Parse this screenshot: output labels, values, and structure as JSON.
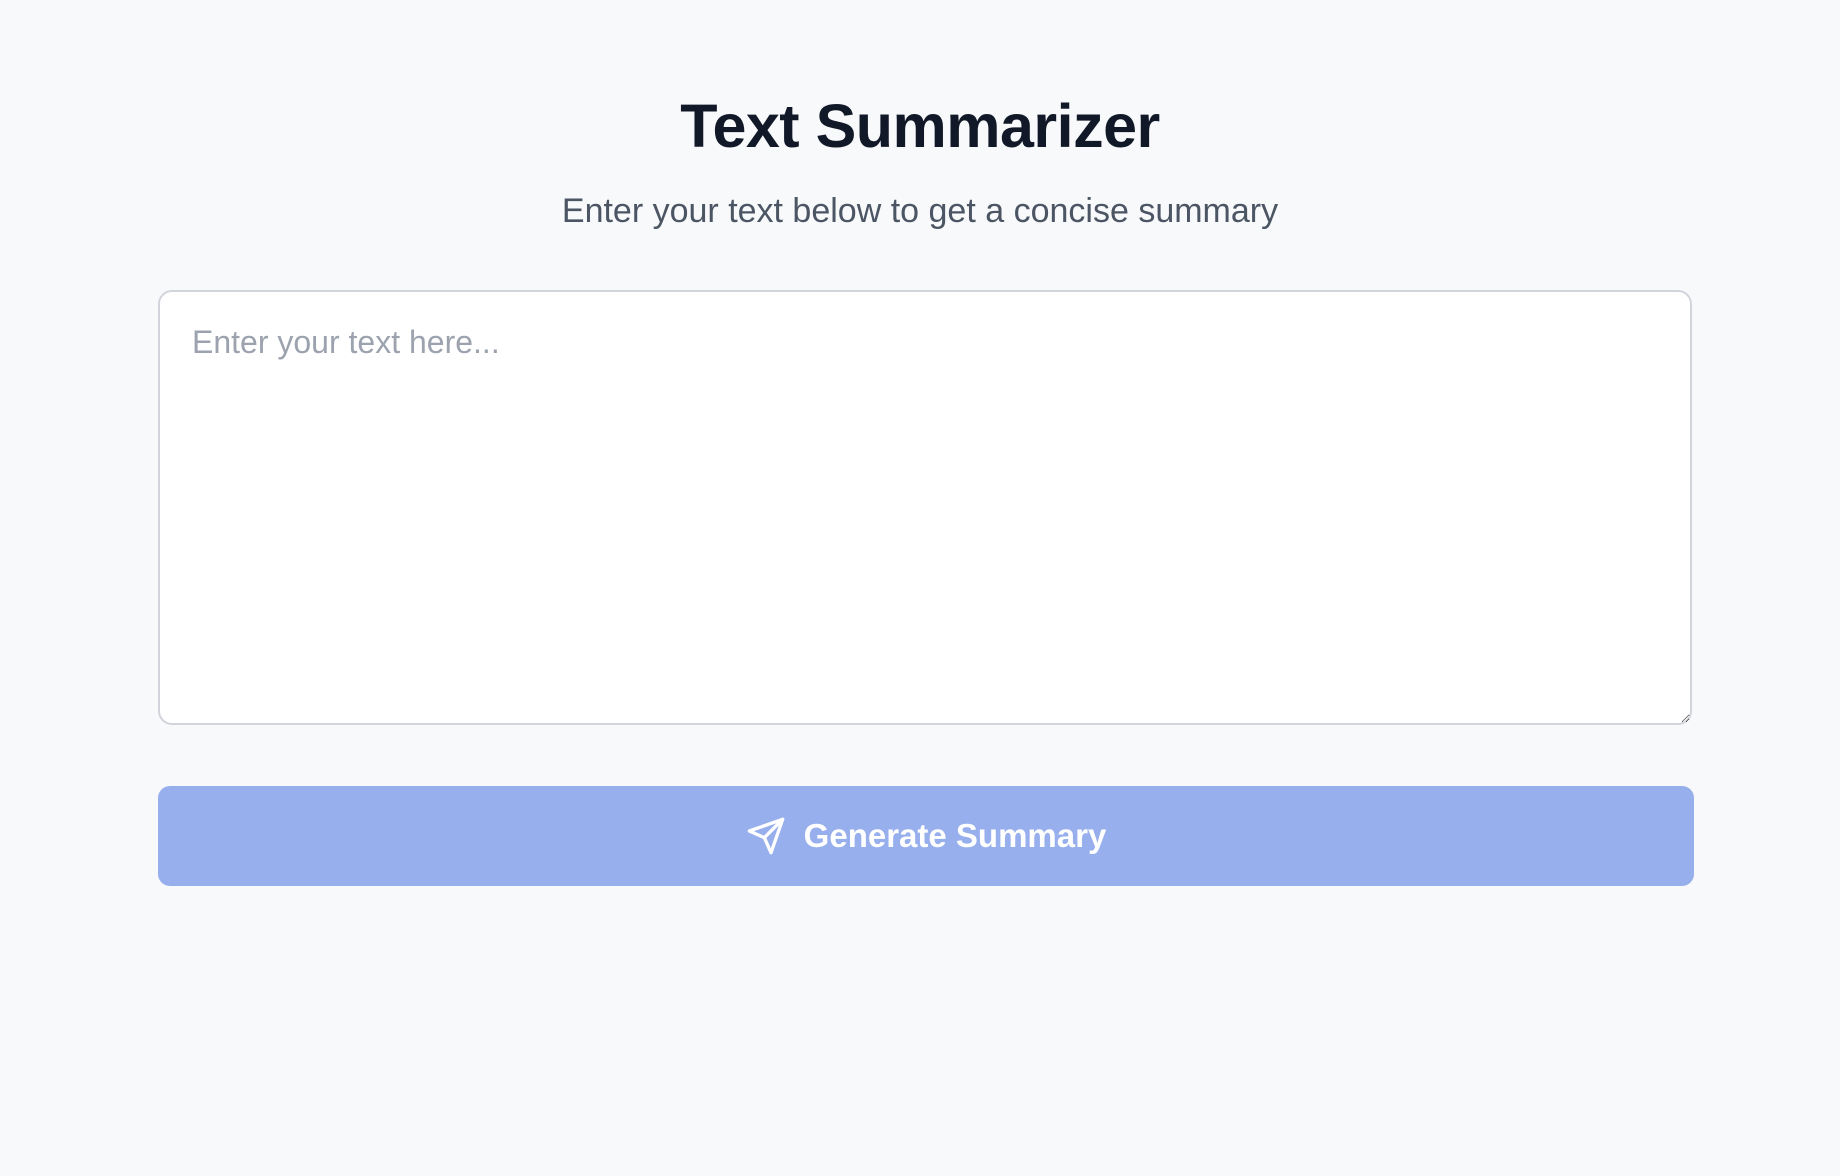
{
  "header": {
    "title": "Text Summarizer",
    "subtitle": "Enter your text below to get a concise summary"
  },
  "input": {
    "placeholder": "Enter your text here...",
    "value": ""
  },
  "button": {
    "label": "Generate Summary",
    "icon": "send-icon"
  },
  "colors": {
    "background": "#f8f9fb",
    "button": "#98afed",
    "title": "#111827",
    "subtitle": "#4b5563"
  }
}
